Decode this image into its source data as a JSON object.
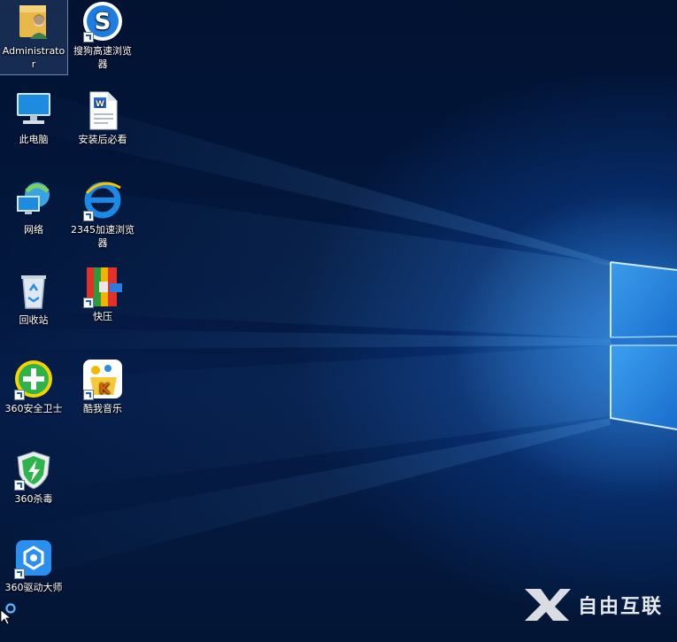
{
  "desktop": {
    "icons": [
      {
        "id": "administrator",
        "label": "Administrator",
        "icon": "user-folder-icon"
      },
      {
        "id": "sogou-browser",
        "label": "搜狗高速浏览器",
        "icon": "sogou-browser-icon"
      },
      {
        "id": "this-pc",
        "label": "此电脑",
        "icon": "computer-icon"
      },
      {
        "id": "install-readme",
        "label": "安装后必看",
        "icon": "wps-document-icon"
      },
      {
        "id": "network",
        "label": "网络",
        "icon": "network-icon"
      },
      {
        "id": "browser-2345",
        "label": "2345加速浏览器",
        "icon": "ie-browser-icon"
      },
      {
        "id": "recycle-bin",
        "label": "回收站",
        "icon": "recycle-bin-icon"
      },
      {
        "id": "kuaiya",
        "label": "快压",
        "icon": "kuaiya-icon"
      },
      {
        "id": "safe-360",
        "label": "360安全卫士",
        "icon": "360-safe-icon"
      },
      {
        "id": "kuwo-music",
        "label": "酷我音乐",
        "icon": "kuwo-music-icon"
      },
      {
        "id": "antivirus-360",
        "label": "360杀毒",
        "icon": "360-antivirus-icon"
      },
      {
        "id": "driver-360",
        "label": "360驱动大师",
        "icon": "360-driver-icon"
      }
    ]
  },
  "watermark": {
    "text": "自由互联"
  },
  "colors": {
    "accent": "#1e78dc",
    "background": "#02122b"
  }
}
